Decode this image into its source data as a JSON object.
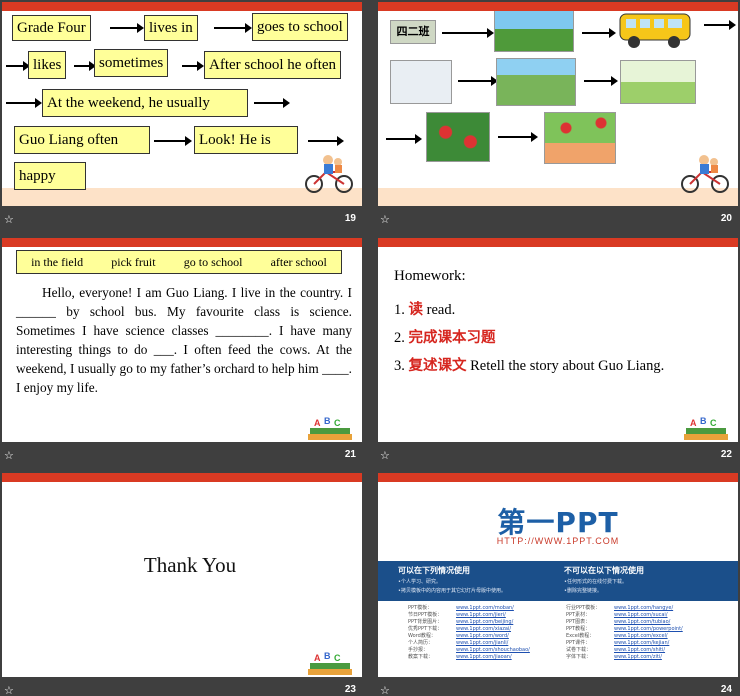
{
  "slides": {
    "s19": {
      "number": "19",
      "boxes": [
        "Grade Four",
        "lives in",
        "goes to school",
        "likes",
        "sometimes",
        "After school he often",
        "At the weekend, he usually",
        "Guo Liang  often",
        "Look!  He is",
        "happy"
      ]
    },
    "s20": {
      "number": "20",
      "label": "四二班"
    },
    "s21": {
      "number": "21",
      "word_bank": [
        "in the field",
        "pick fruit",
        "go to school",
        "after school"
      ],
      "paragraph": "Hello, everyone! I am Guo Liang. I live in the country. I ______ by school bus. My favourite class is science. Sometimes I have science classes ________. I have many interesting things to do ___. I often feed the cows. At the weekend, I usually go to my father’s orchard to help him ____. I enjoy my life."
    },
    "s22": {
      "number": "22",
      "title": "Homework:",
      "items": [
        {
          "n": "1.",
          "zh": "读",
          "en": "read."
        },
        {
          "n": "2.",
          "zh": "完成课本习题",
          "en": ""
        },
        {
          "n": "3.",
          "zh": "复述课文",
          "en": "Retell the story about Guo Liang."
        }
      ]
    },
    "s23": {
      "number": "23",
      "text": "Thank You"
    },
    "s24": {
      "number": "24",
      "logo": "第一PPT",
      "url": "HTTP://WWW.1PPT.COM",
      "left_title": "可以在下列情况使用",
      "left_items": [
        "•个人学习、研究。",
        "•拷贝模板中的内容用于其它幻灯片母版中使用。"
      ],
      "right_title": "不可以在以下情况使用",
      "right_items": [
        "•任何形式的在线付费下载。",
        "•删除完整链接。"
      ],
      "links_left": [
        [
          "PPT模板：",
          "www.1ppt.com/moban/"
        ],
        [
          "节日PPT模板：",
          "www.1ppt.com/jieri/"
        ],
        [
          "PPT背景图片：",
          "www.1ppt.com/beijing/"
        ],
        [
          "优秀PPT下载：",
          "www.1ppt.com/xiazai/"
        ],
        [
          "Word教程：",
          "www.1ppt.com/word/"
        ],
        [
          "个人简历：",
          "www.1ppt.com/jianli/"
        ],
        [
          "手抄报：",
          "www.1ppt.com/shouchaobao/"
        ],
        [
          "教案下载：",
          "www.1ppt.com/jiaoan/"
        ]
      ],
      "links_right": [
        [
          "行业PPT模板：",
          "www.1ppt.com/hangye/"
        ],
        [
          "PPT素材：",
          "www.1ppt.com/sucai/"
        ],
        [
          "PPT图表：",
          "www.1ppt.com/tubiao/"
        ],
        [
          "PPT教程：",
          "www.1ppt.com/powerpoint/"
        ],
        [
          "Excel教程：",
          "www.1ppt.com/excel/"
        ],
        [
          "PPT课件：",
          "www.1ppt.com/kejian/"
        ],
        [
          "试卷下载：",
          "www.1ppt.com/shiti/"
        ],
        [
          "字体下载：",
          "www.1ppt.com/ziti/"
        ]
      ]
    }
  },
  "star_icon": "☆"
}
